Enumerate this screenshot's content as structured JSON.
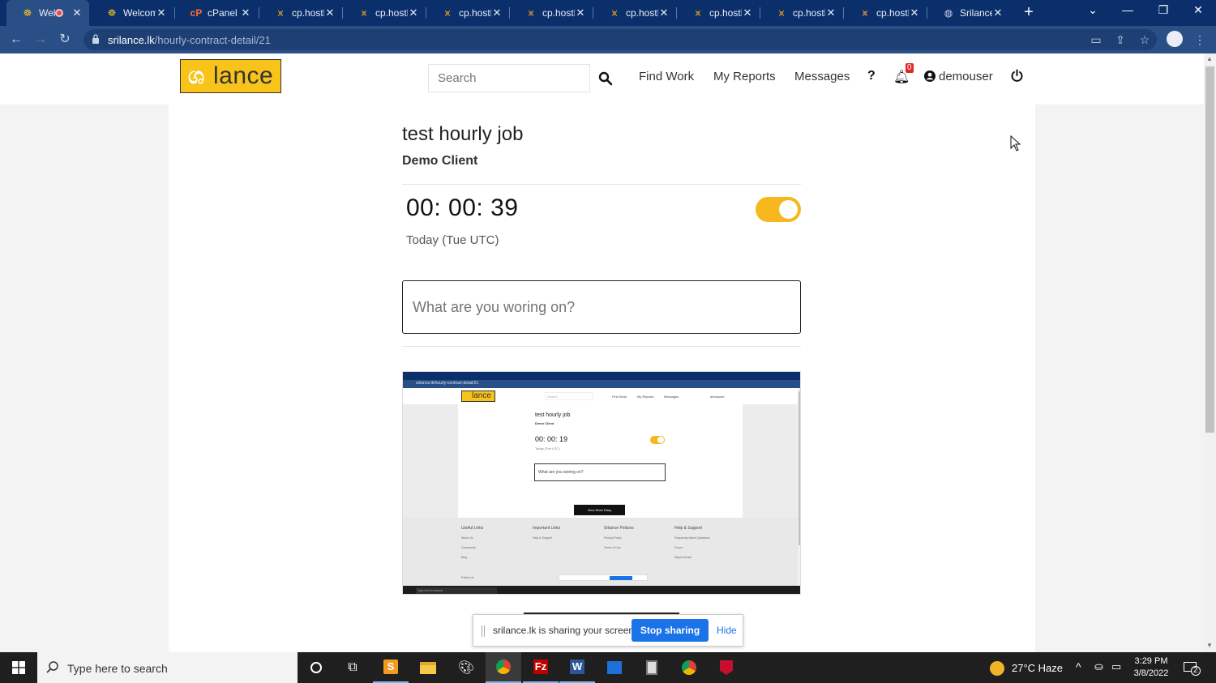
{
  "browser": {
    "tabs": [
      {
        "title": "Welc",
        "icon": "srilance-icon"
      },
      {
        "title": "Welcome",
        "icon": "srilance-icon"
      },
      {
        "title": "cPanel -",
        "icon": "cpanel-icon"
      },
      {
        "title": "cp.hosth",
        "icon": "hosting-icon"
      },
      {
        "title": "cp.hosth",
        "icon": "hosting-icon"
      },
      {
        "title": "cp.hosth",
        "icon": "hosting-icon"
      },
      {
        "title": "cp.hosth",
        "icon": "hosting-icon"
      },
      {
        "title": "cp.hosth",
        "icon": "hosting-icon"
      },
      {
        "title": "cp.hosth",
        "icon": "hosting-icon"
      },
      {
        "title": "cp.hosth",
        "icon": "hosting-icon"
      },
      {
        "title": "cp.hosth",
        "icon": "hosting-icon"
      },
      {
        "title": "Srilance",
        "icon": "globe-icon"
      }
    ],
    "url_host": "srilance.lk",
    "url_path": "/hourly-contract-detail/21"
  },
  "site": {
    "logo_text": "lance",
    "search_placeholder": "Search",
    "nav": {
      "find_work": "Find Work",
      "my_reports": "My Reports",
      "messages": "Messages",
      "help": "?",
      "notifications_count": "0",
      "username": "demouser"
    }
  },
  "job": {
    "title": "test hourly job",
    "client": "Demo Client",
    "timer": "00: 00: 39",
    "tracking_on": true,
    "today_label": "Today (Tue UTC)",
    "work_prompt": "What are you woring on?"
  },
  "screenshot_preview": {
    "url": "srilance.lk/hourly-contract-detail/21",
    "search": "Search",
    "nav": [
      "Find Work",
      "My Reports",
      "Messages",
      "demouser"
    ],
    "job_title": "test hourly job",
    "client": "Demo Client",
    "timer": "00: 00: 19",
    "today_label": "Today (Tue UTC)",
    "work_prompt": "What are you woring on?",
    "button": "View Work Diary",
    "footer": [
      {
        "heading": "Useful Links",
        "links": [
          "About Us",
          "Community",
          "Blog"
        ]
      },
      {
        "heading": "Important Links",
        "links": [
          "Help & Support"
        ]
      },
      {
        "heading": "Srilance Policies",
        "links": [
          "Privacy Policy",
          "Terms of Use"
        ]
      },
      {
        "heading": "Help & Support",
        "links": [
          "Frequently Asked Questions",
          "Forum",
          "Report Abuse"
        ]
      }
    ],
    "follow": "Follow Us",
    "taskbar_search": "Type here to search"
  },
  "share_bar": {
    "message": "srilance.lk is sharing your screen.",
    "stop": "Stop sharing",
    "hide": "Hide"
  },
  "taskbar": {
    "search_placeholder": "Type here to search",
    "weather": "27°C  Haze",
    "time": "3:29 PM",
    "date": "3/8/2022",
    "notification_count": "2"
  },
  "colors": {
    "brand_yellow": "#f8c41a",
    "toggle_on": "#f6b81e",
    "chrome_dark": "#0b2f6b",
    "chrome_toolbar": "#2a4f86",
    "share_blue": "#1a73e8"
  }
}
